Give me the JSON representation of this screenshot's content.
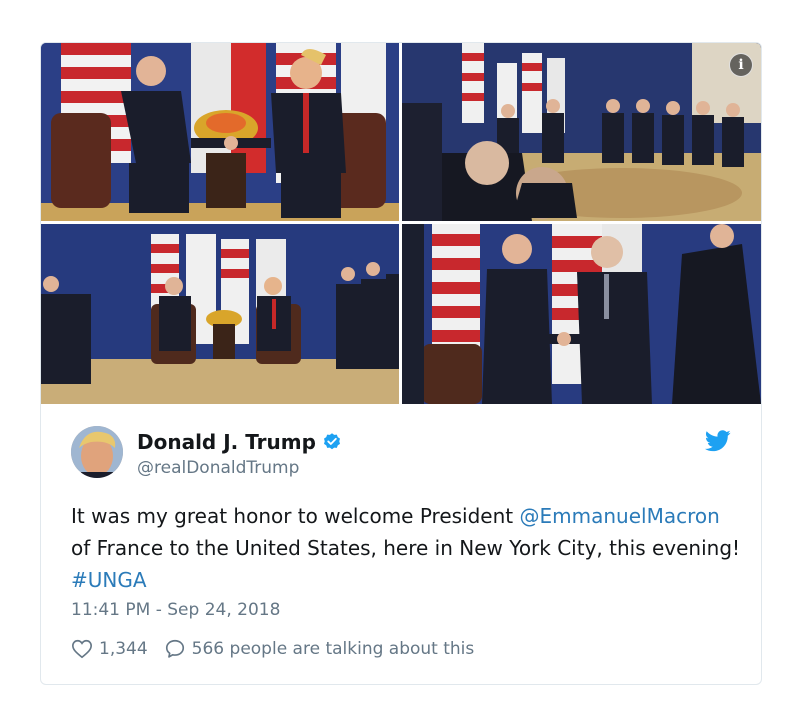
{
  "tweet": {
    "display_name": "Donald J. Trump",
    "handle": "@realDonaldTrump",
    "text_part1": "It was my great honor to welcome President ",
    "mention": "@EmmanuelMacron",
    "text_part2": " of France to the United States, here in New York City, this evening! ",
    "hashtag": "#UNGA",
    "timestamp": "11:41 PM - Sep 24, 2018",
    "likes": "1,344",
    "talking": "566 people are talking about this"
  },
  "icons": {
    "verified": "verified-badge-icon",
    "bird": "twitter-bird-icon",
    "info": "info-icon",
    "heart": "heart-icon",
    "reply": "speech-bubble-icon"
  },
  "colors": {
    "link": "#2b7bb9",
    "verified": "#1da1f2",
    "muted": "#657786",
    "text": "#14171a"
  }
}
